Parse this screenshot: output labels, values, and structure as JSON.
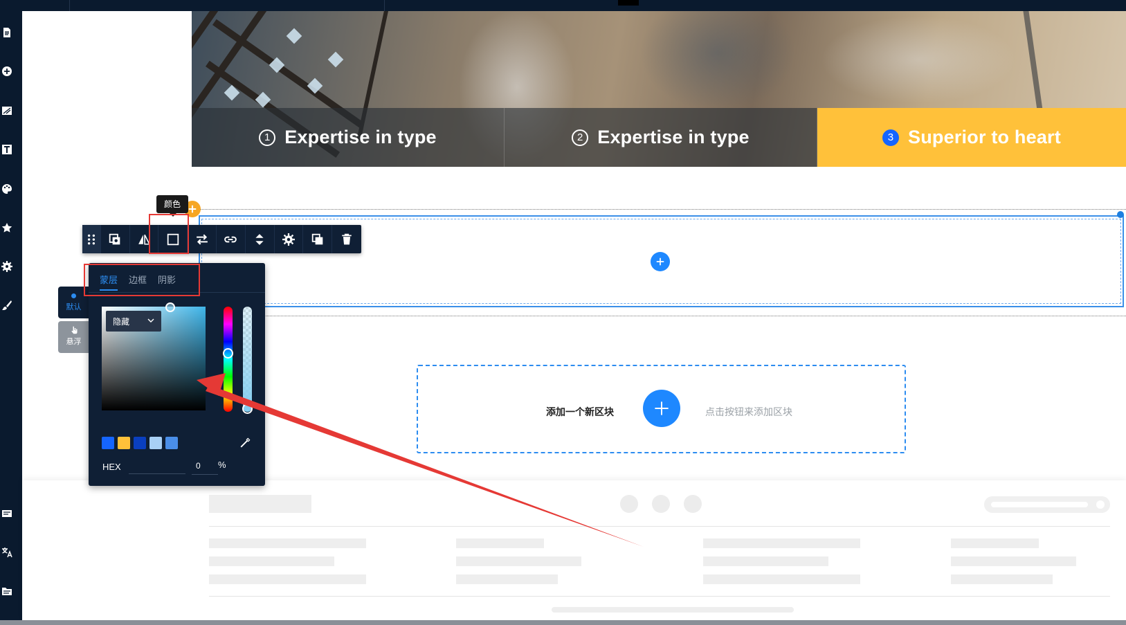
{
  "hero": {
    "tabs": [
      {
        "num": "1",
        "label": "Expertise in type"
      },
      {
        "num": "2",
        "label": "Expertise in type"
      },
      {
        "num": "3",
        "label": "Superior to heart"
      }
    ]
  },
  "toolbar": {
    "tooltip": "颜色",
    "icons": [
      "drag-handle-icon",
      "copy-style-icon",
      "mirror-icon",
      "color-square-icon",
      "swap-icon",
      "link-icon",
      "sort-icon",
      "gear-icon",
      "duplicate-icon",
      "trash-icon"
    ]
  },
  "states": {
    "default_label": "默认",
    "hover_label": "悬浮"
  },
  "color_panel": {
    "tabs": [
      "蒙层",
      "边框",
      "阴影"
    ],
    "active_tab": "蒙层",
    "mode_select": "隐藏",
    "swatches": [
      "#1565ff",
      "#ffc13a",
      "#0a3fbf",
      "#a8d0f5",
      "#4a8ee8"
    ],
    "hex_label": "HEX",
    "hex_value": "",
    "alpha_value": "0",
    "alpha_unit": "%"
  },
  "new_block": {
    "label": "添加一个新区块",
    "hint": "点击按钮来添加区块"
  },
  "colors": {
    "accent": "#1e88ff",
    "gold": "#ffc13a",
    "dark": "#0f1f35",
    "annotation": "#e53935"
  }
}
